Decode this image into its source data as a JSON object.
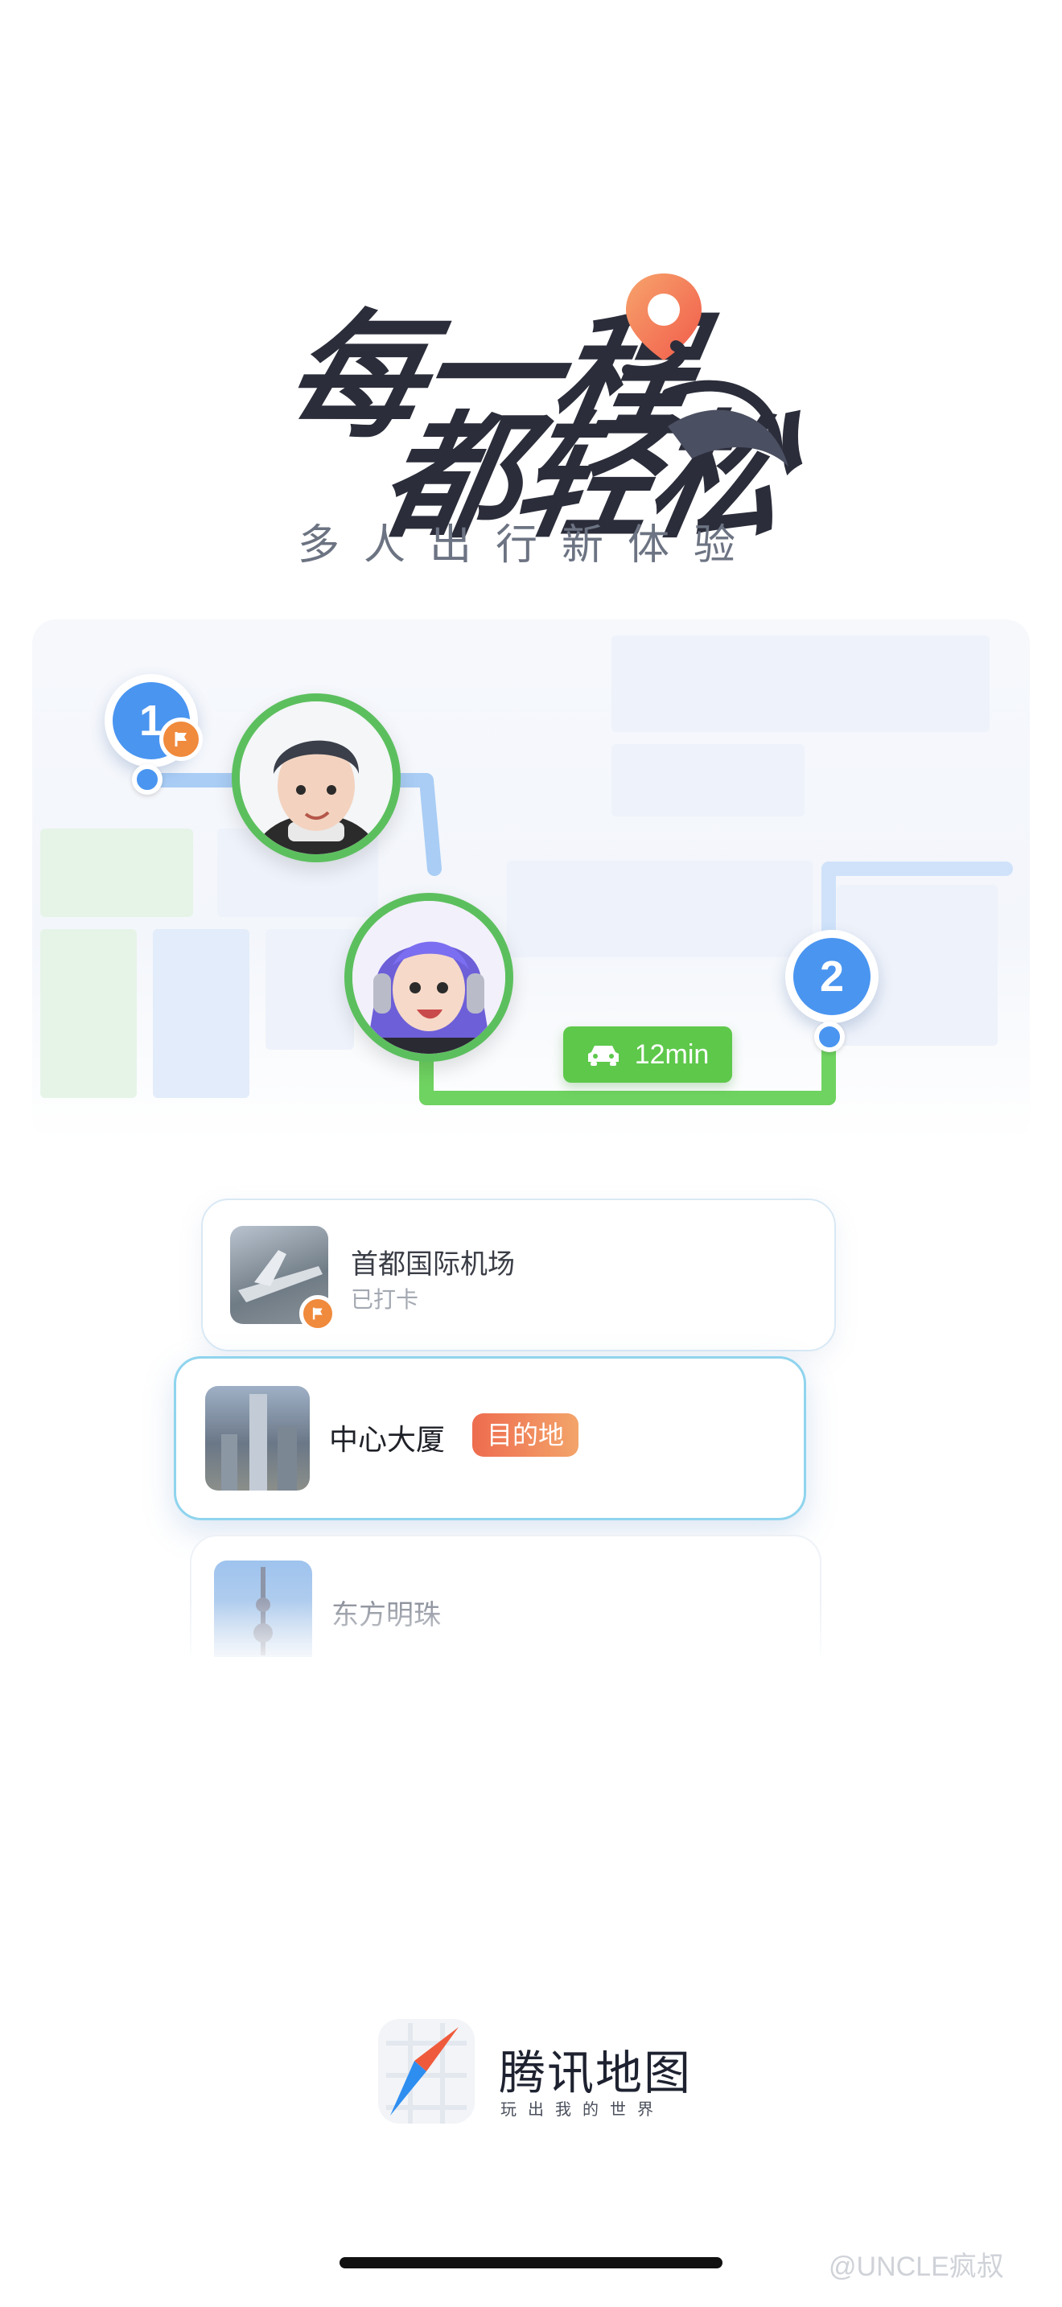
{
  "hero": {
    "title_line1": "每一程",
    "title_line2": "都轻松",
    "subtitle": "多人出行新体验",
    "pin_colors": [
      "#f15a4a",
      "#f7a46c"
    ]
  },
  "map": {
    "markers": [
      {
        "label": "1",
        "color": "#4a95f0",
        "badge_icon": "flag-icon"
      },
      {
        "label": "2",
        "color": "#4a95f0"
      }
    ],
    "avatar_ring_color": "#5cbf5e",
    "route_color": "#6fd361",
    "eta": {
      "icon": "car-icon",
      "text": "12min",
      "color": "#5ec84b"
    }
  },
  "stops": [
    {
      "name": "首都国际机场",
      "status": "已打卡",
      "badge_icon": "flag-icon"
    },
    {
      "name": "中心大厦",
      "tag": "目的地"
    },
    {
      "name": "东方明珠"
    }
  ],
  "brand": {
    "name": "腾讯地图",
    "slogan": "玩出我的世界"
  },
  "watermark": "@UNCLE疯叔"
}
